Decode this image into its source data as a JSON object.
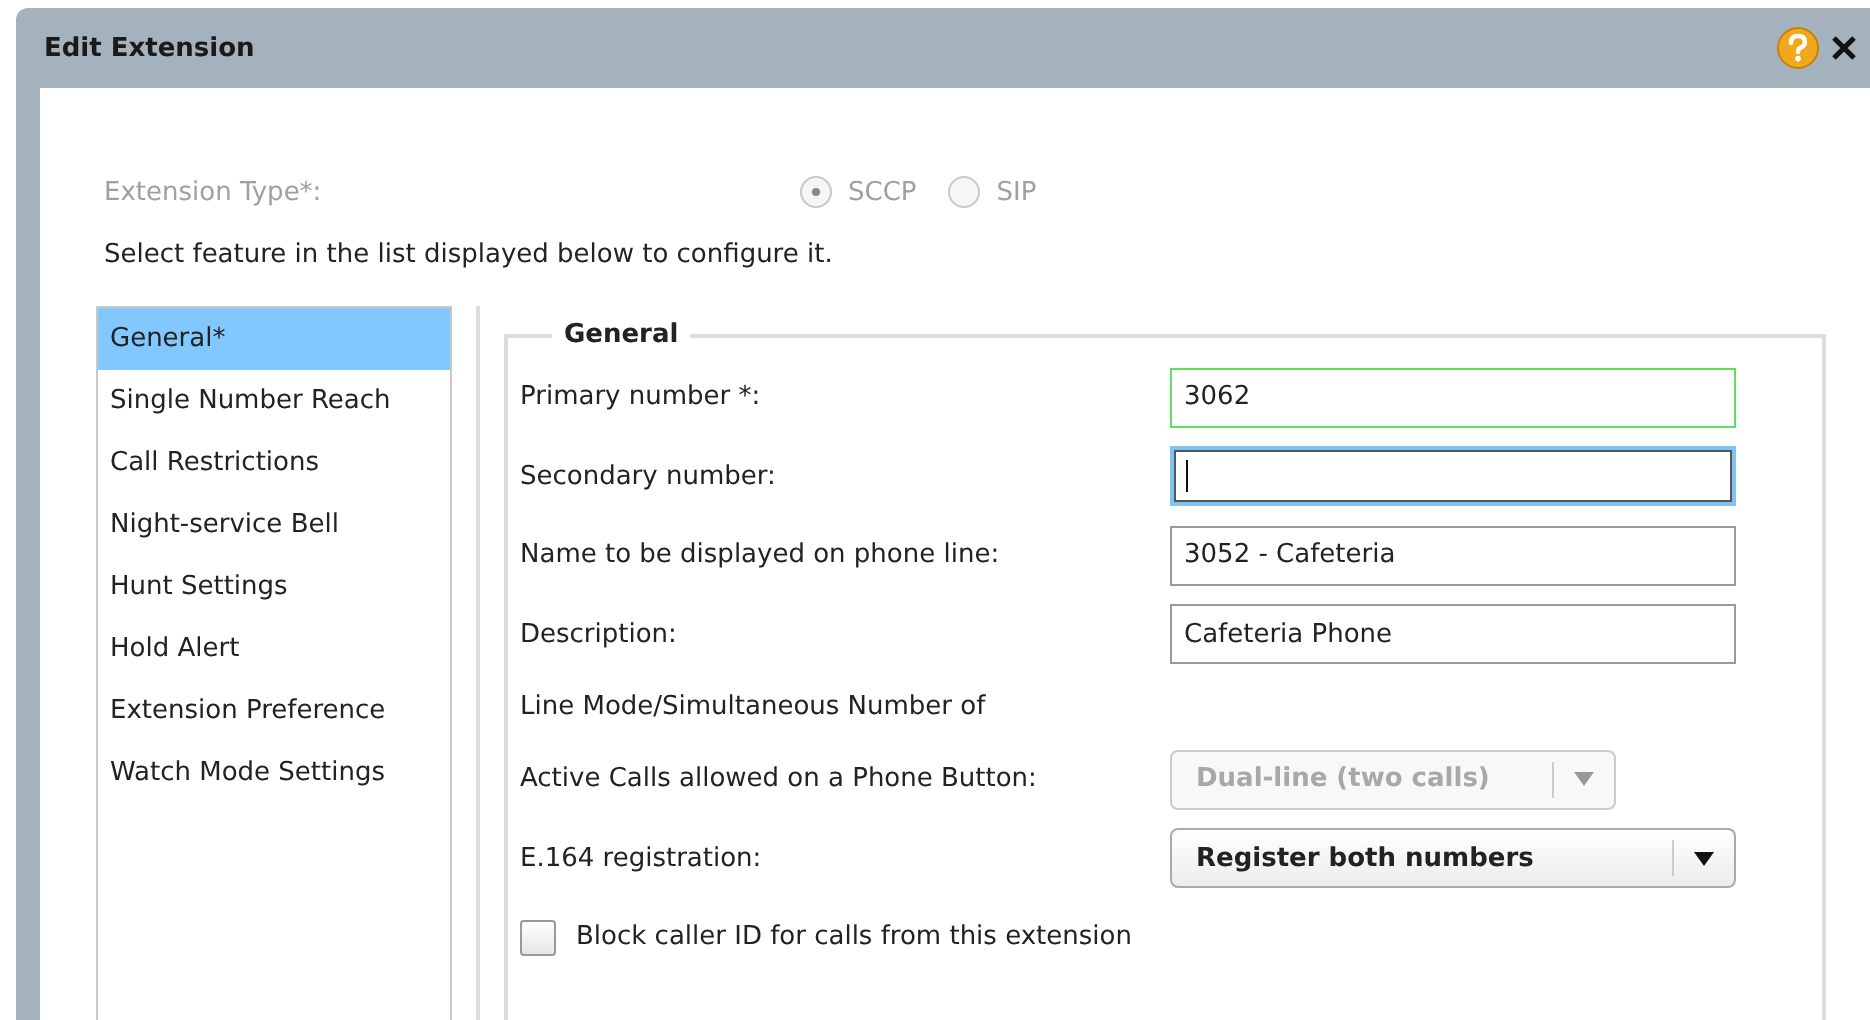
{
  "dialog": {
    "title": "Edit Extension"
  },
  "extension_type": {
    "label": "Extension Type*:",
    "disabled": true,
    "options": [
      {
        "label": "SCCP",
        "selected": true
      },
      {
        "label": "SIP",
        "selected": false
      }
    ]
  },
  "instruction": "Select feature in the list displayed below to configure it.",
  "features": [
    {
      "label": "General*",
      "selected": true
    },
    {
      "label": "Single Number Reach",
      "selected": false
    },
    {
      "label": "Call Restrictions",
      "selected": false
    },
    {
      "label": "Night-service Bell",
      "selected": false
    },
    {
      "label": "Hunt Settings",
      "selected": false
    },
    {
      "label": "Hold Alert",
      "selected": false
    },
    {
      "label": "Extension Preference",
      "selected": false
    },
    {
      "label": "Watch Mode Settings",
      "selected": false
    }
  ],
  "section": {
    "legend": "General",
    "rows": [
      {
        "kind": "input",
        "label": "Primary number *:",
        "value": "3062",
        "valid": true,
        "focused": false
      },
      {
        "kind": "input",
        "label": "Secondary number:",
        "valid": false,
        "focused": true
      },
      {
        "kind": "input",
        "label": "Name to be displayed on phone line:",
        "value": "3052 - Cafeteria",
        "valid": false,
        "focused": false
      },
      {
        "kind": "input",
        "label": "Description:",
        "value": "Cafeteria Phone",
        "valid": false,
        "focused": false
      },
      {
        "kind": "text",
        "label": "Line Mode/Simultaneous Number of"
      },
      {
        "kind": "select",
        "label": "Active Calls allowed on a Phone Button:",
        "value": "Dual-line (two calls)",
        "disabled": true
      },
      {
        "kind": "select",
        "label": "E.164 registration:",
        "value": "Register both numbers",
        "disabled": false
      },
      {
        "kind": "checkbox",
        "label": "Block caller ID for calls from this extension",
        "checked": false
      }
    ]
  }
}
